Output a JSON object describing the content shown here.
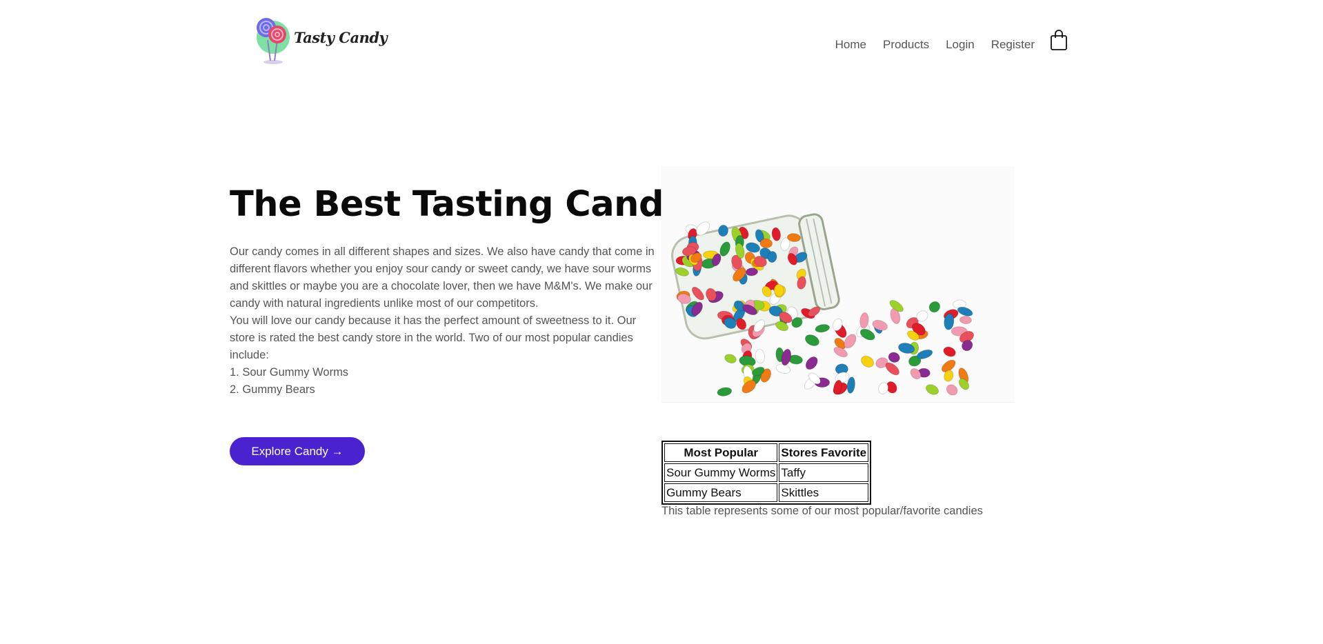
{
  "header": {
    "brand": "Tasty Candy",
    "nav": [
      "Home",
      "Products",
      "Login",
      "Register"
    ]
  },
  "hero": {
    "title": "The Best Tasting Candy!",
    "paragraph1": "Our candy comes in all different shapes and sizes. We also have candy that come in different flavors whether you enjoy sour candy or sweet candy, we have sour worms and skittles or maybe you are a chocolate lover, then we have M&M's. We make our candy with natural ingredients unlike most of our competitors.",
    "paragraph2": "You will love our candy because it has the perfect amount of sweetness to it. Our store is rated the best candy store in the world. Two of our most popular candies include:",
    "list": [
      "1. Sour Gummy Worms",
      "2. Gummy Bears"
    ],
    "cta": "Explore Candy →"
  },
  "table": {
    "headers": [
      "Most Popular",
      "Stores Favorite"
    ],
    "rows": [
      [
        "Sour Gummy Worms",
        "Taffy"
      ],
      [
        "Gummy Bears",
        "Skittles"
      ]
    ],
    "caption": "This table represents some of our most popular/favorite candies"
  },
  "colors": {
    "accent": "#4a22cf",
    "heading": "#0a0a0a",
    "body_text": "#555555"
  },
  "icons": [
    "lollipop-logo-icon",
    "shopping-bag-icon"
  ]
}
